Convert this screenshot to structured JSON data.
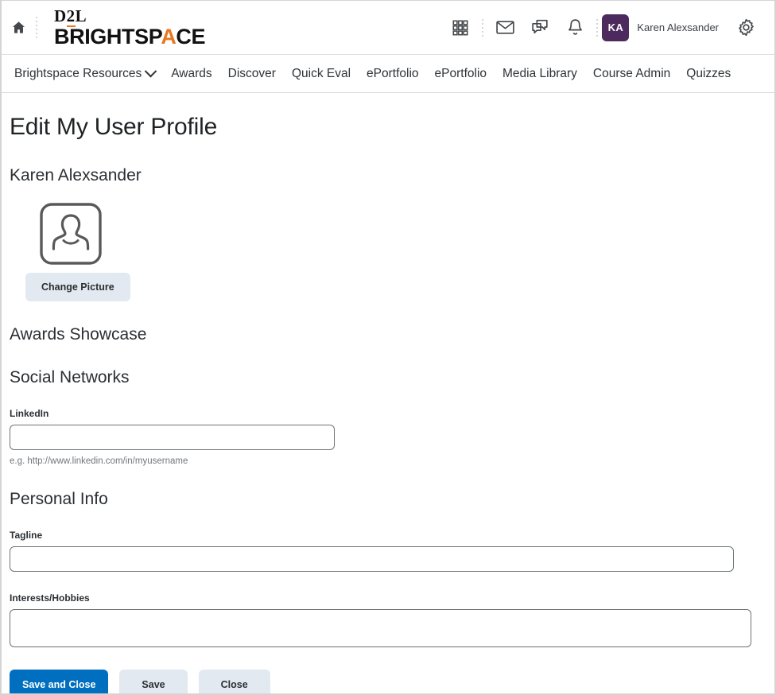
{
  "header": {
    "home_icon": "home-icon",
    "brand": {
      "line1": "D2L",
      "line1_pre": "D",
      "line1_mid": "2",
      "line1_post": "L",
      "line2_pre": "BRIGHTSP",
      "line2_flame": "A",
      "line2_post": "CE"
    },
    "icons": [
      {
        "name": "waffle-grid-icon",
        "label": "Course Selector"
      },
      {
        "name": "envelope-icon",
        "label": "Email"
      },
      {
        "name": "chat-bubbles-icon",
        "label": "Messages"
      },
      {
        "name": "bell-icon",
        "label": "Notifications"
      },
      {
        "name": "gear-icon",
        "label": "Settings"
      }
    ],
    "user": {
      "initials": "KA",
      "name": "Karen Alexsander",
      "avatar_color": "#4c2a5e"
    }
  },
  "nav": {
    "items": [
      {
        "label": "Brightspace Resources",
        "has_caret": true
      },
      {
        "label": "Awards",
        "has_caret": false
      },
      {
        "label": "Discover",
        "has_caret": false
      },
      {
        "label": "Quick Eval",
        "has_caret": false
      },
      {
        "label": "ePortfolio",
        "has_caret": false
      },
      {
        "label": "ePortfolio",
        "has_caret": false
      },
      {
        "label": "Media Library",
        "has_caret": false
      },
      {
        "label": "Course Admin",
        "has_caret": false
      },
      {
        "label": "Quizzes",
        "has_caret": false
      }
    ]
  },
  "main": {
    "page_title": "Edit My User Profile",
    "profile_name": "Karen Alexsander",
    "change_picture_label": "Change Picture",
    "sections": {
      "awards_showcase": "Awards Showcase",
      "social_networks": "Social Networks",
      "personal_info": "Personal Info"
    },
    "fields": {
      "linkedin": {
        "label": "LinkedIn",
        "value": "",
        "placeholder": "",
        "helper": "e.g. http://www.linkedin.com/in/myusername"
      },
      "tagline": {
        "label": "Tagline",
        "value": "",
        "placeholder": ""
      },
      "interests": {
        "label": "Interests/Hobbies",
        "value": "",
        "placeholder": ""
      }
    },
    "buttons": {
      "save_and_close": "Save and Close",
      "save": "Save",
      "close": "Close"
    }
  },
  "colors": {
    "primary_blue": "#006fbf",
    "secondary_grey": "#e3e9f0",
    "brand_orange": "#e87722",
    "avatar_purple": "#4c2a5e"
  }
}
